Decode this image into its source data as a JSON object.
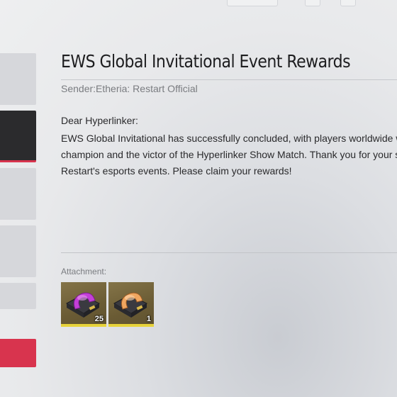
{
  "sidebar": {
    "tabs": [
      {
        "state": "normal"
      },
      {
        "state": "active"
      },
      {
        "state": "normal"
      },
      {
        "state": "normal"
      },
      {
        "state": "normal"
      },
      {
        "state": "highlight"
      }
    ]
  },
  "mail": {
    "title": "EWS Global Invitational Event Rewards",
    "sender": "Sender:Etheria: Restart Official",
    "greeting": "Dear Hyperlinker:",
    "body_lines": [
      "EWS Global Invitational has successfully concluded, with players worldwide witn",
      "champion and the victor of the Hyperlinker Show Match. Thank you for your sup",
      "Restart's esports events. Please claim your rewards!"
    ]
  },
  "attachment": {
    "label": "Attachment:",
    "items": [
      {
        "icon": "purple-gear-item-icon",
        "quantity": "25"
      },
      {
        "icon": "orange-gear-item-icon",
        "quantity": "1"
      }
    ]
  },
  "colors": {
    "accent_red": "#d8344e",
    "active_tab": "#2b2b2d",
    "item_frame": "#6e5f38",
    "rarity_bar": "#e7d33a",
    "purple_item": "#c43fd8",
    "orange_item": "#f0a660"
  }
}
